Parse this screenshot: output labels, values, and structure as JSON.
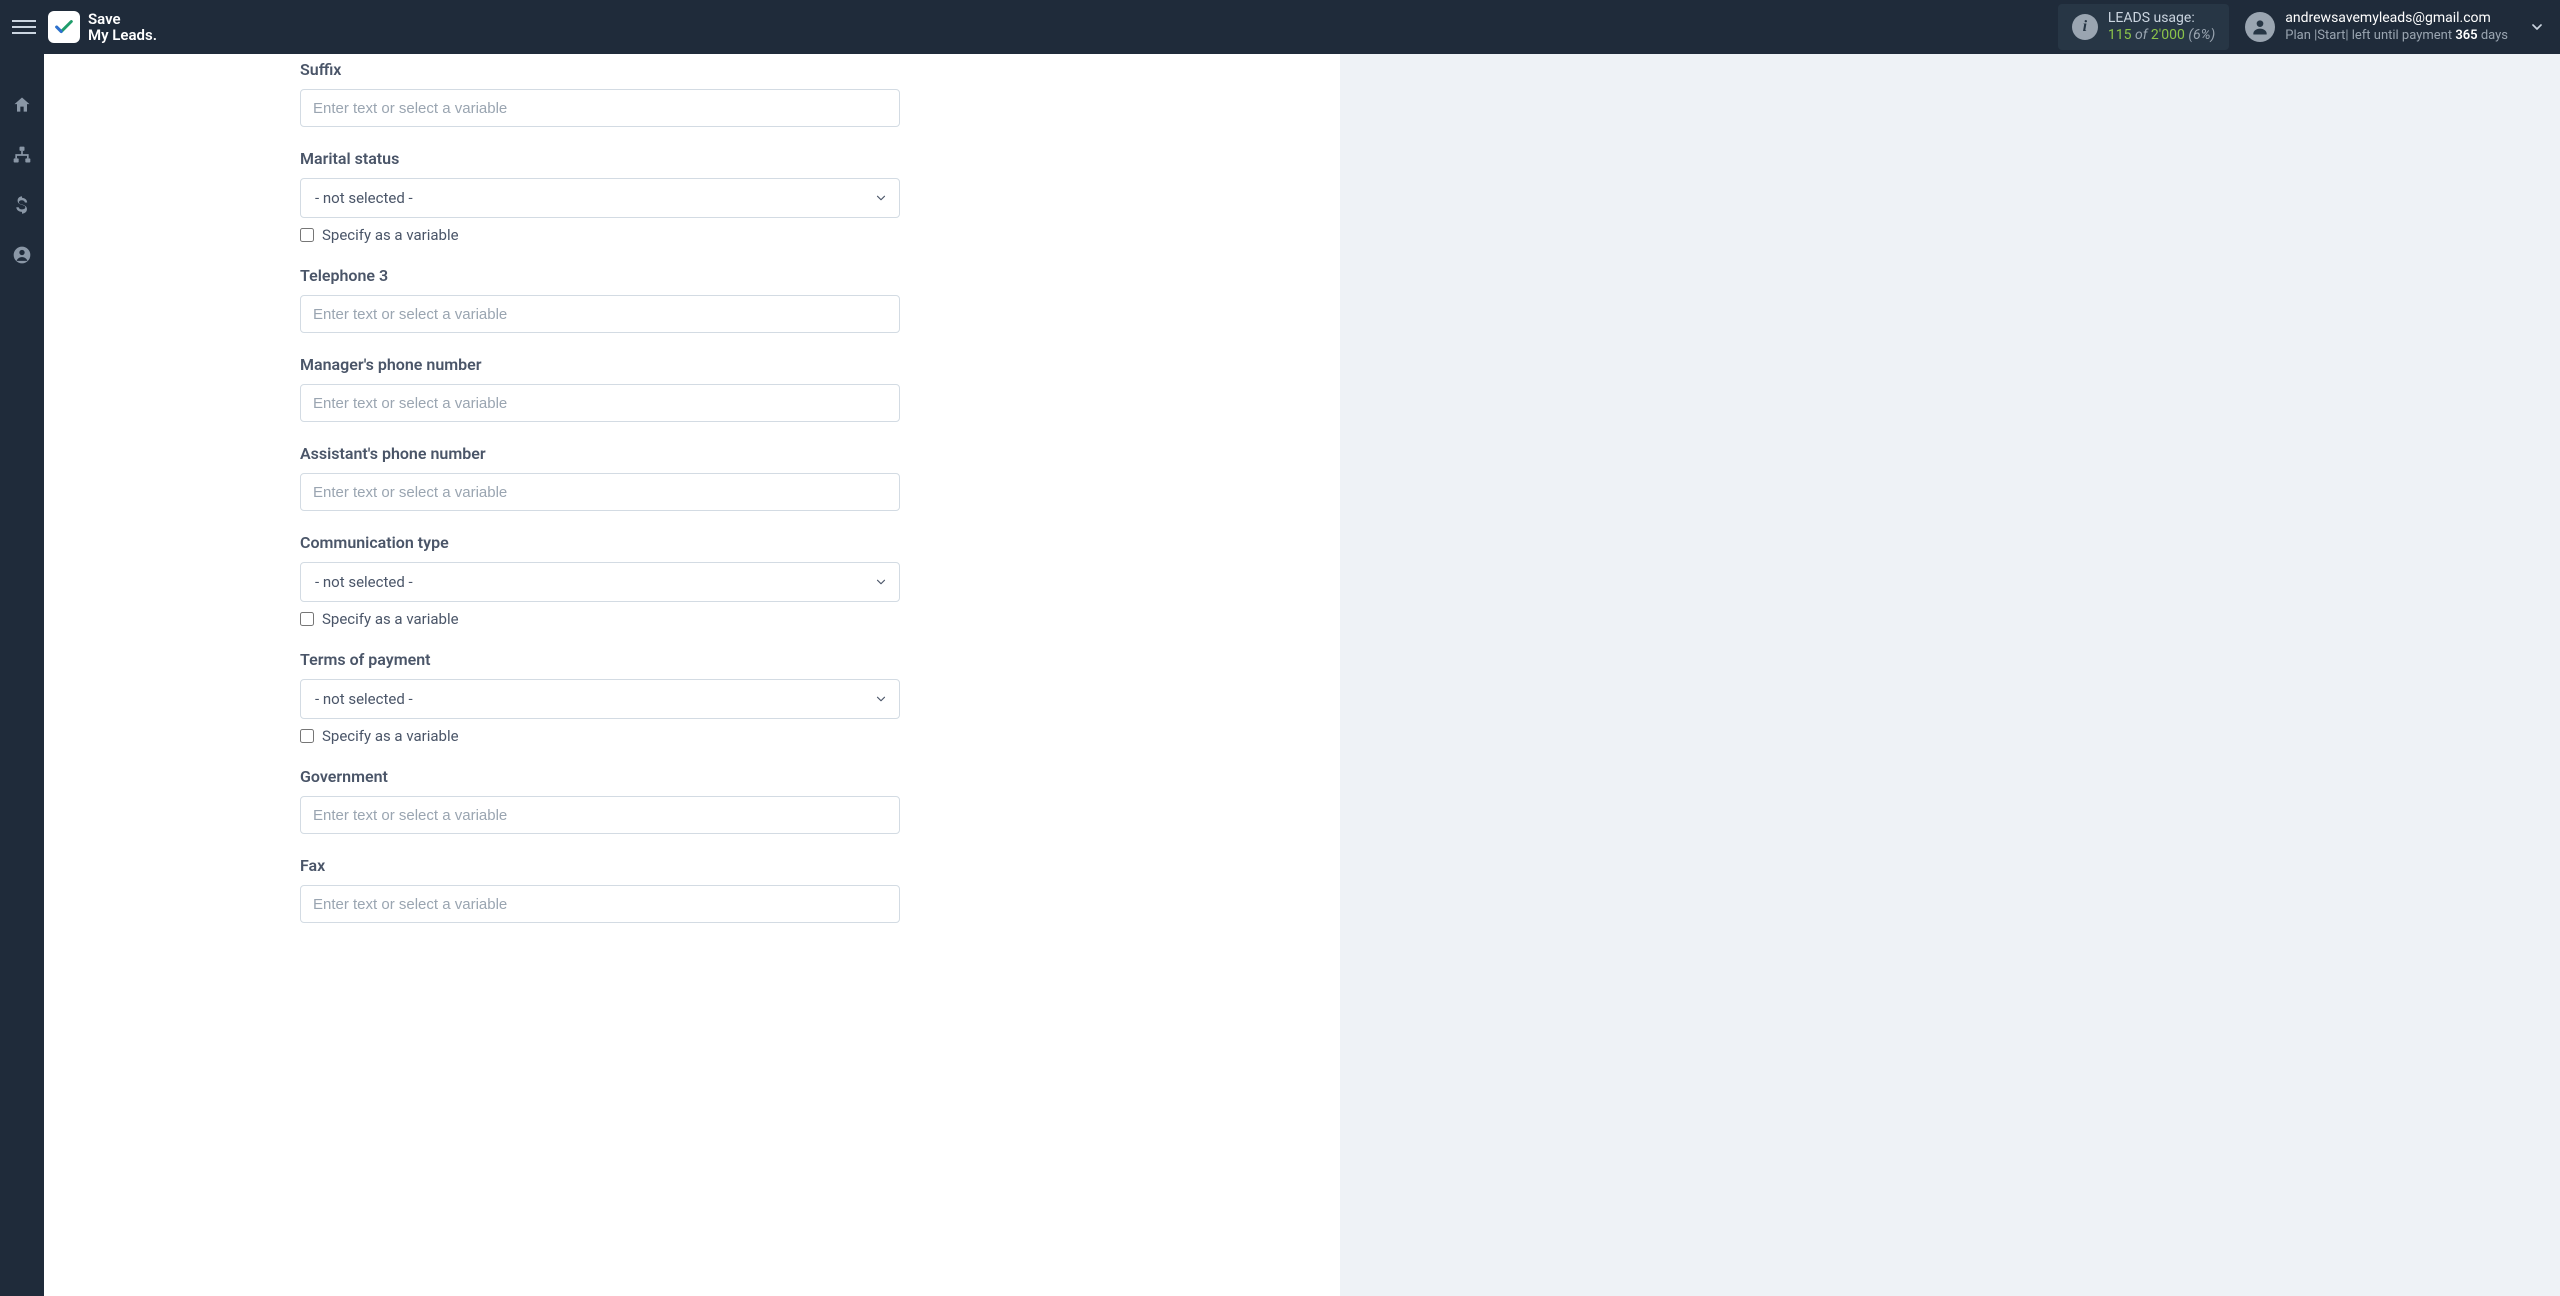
{
  "brand": {
    "line1": "Save",
    "line2": "My Leads."
  },
  "header": {
    "leads": {
      "label": "LEADS usage:",
      "used": "115",
      "of": "of",
      "total": "2'000",
      "pct": "(6%)"
    },
    "user": {
      "email": "andrewsavemyleads@gmail.com",
      "plan_prefix": "Plan |",
      "plan_name": "Start",
      "plan_mid": "| left until payment ",
      "days": "365",
      "days_suffix": " days"
    }
  },
  "placeholders": {
    "text_or_var": "Enter text or select a variable"
  },
  "labels": {
    "specify_variable": "Specify as a variable"
  },
  "selects": {
    "not_selected": "- not selected -"
  },
  "fields": {
    "suffix": {
      "label": "Suffix"
    },
    "marital_status": {
      "label": "Marital status"
    },
    "telephone3": {
      "label": "Telephone 3"
    },
    "manager_phone": {
      "label": "Manager's phone number"
    },
    "assistant_phone": {
      "label": "Assistant's phone number"
    },
    "communication_type": {
      "label": "Communication type"
    },
    "terms_of_payment": {
      "label": "Terms of payment"
    },
    "government": {
      "label": "Government"
    },
    "fax": {
      "label": "Fax"
    }
  }
}
